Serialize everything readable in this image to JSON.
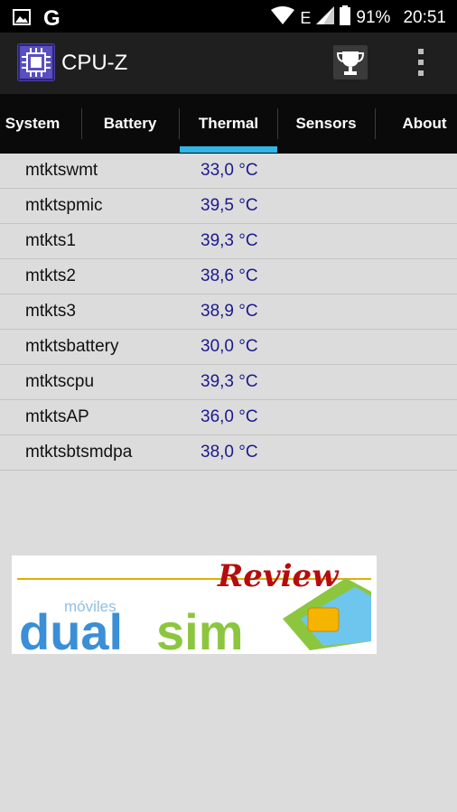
{
  "status_bar": {
    "battery_percent": "91%",
    "time": "20:51",
    "network_type": "E",
    "notification_app_letter": "G"
  },
  "app_bar": {
    "title": "CPU-Z"
  },
  "tabs": [
    {
      "label": "System"
    },
    {
      "label": "Battery"
    },
    {
      "label": "Thermal",
      "active": true
    },
    {
      "label": "Sensors"
    },
    {
      "label": "About"
    }
  ],
  "thermal": {
    "rows": [
      {
        "name": "mtktswmt",
        "value": "33,0 °C"
      },
      {
        "name": "mtktspmic",
        "value": "39,5 °C"
      },
      {
        "name": "mtkts1",
        "value": "39,3 °C"
      },
      {
        "name": "mtkts2",
        "value": "38,6 °C"
      },
      {
        "name": "mtkts3",
        "value": "38,9 °C"
      },
      {
        "name": "mtktsbattery",
        "value": "30,0 °C"
      },
      {
        "name": "mtktscpu",
        "value": "39,3 °C"
      },
      {
        "name": "mtktsAP",
        "value": "36,0 °C"
      },
      {
        "name": "mtktsbtsmdpa",
        "value": "38,0 °C"
      }
    ]
  },
  "banner": {
    "small_text": "móviles",
    "brand_dual": "dual",
    "brand_sim": "sim",
    "script_text": "Review"
  },
  "colors": {
    "accent": "#33b5e5",
    "value_text": "#1a1a8c",
    "background": "#dcdcdc"
  }
}
